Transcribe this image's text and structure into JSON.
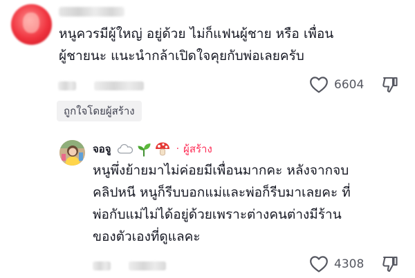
{
  "comments": [
    {
      "body": "หนูควรมีผู้ใหญ่ อยู่ด้วย ไม่ก็แฟนผู้ชาย หรือ เพื่อน\nผู้ชายนะ แนะนำกล้าเปิดใจคุยกับพ่อเลยครับ",
      "like_count": "6604",
      "liked_by_creator_label": "ถูกใจโดยผู้สร้าง"
    },
    {
      "author": "จอจู",
      "creator_label": "ผู้สร้าง",
      "creator_separator": "·",
      "body": "หนูพึ่งย้ายมาไม่ค่อยมีเพื่อนมากคะ หลังจากจบ\nคลิปหนี หนูก็รีบบอกแม่และพ่อก็รีบมาเลยคะ ที่\nพ่อกับแม่ไม่ได้อยู่ด้วยเพราะต่างคนต่างมีร้าน\nของตัวเองที่ดูแลคะ",
      "like_count": "4308"
    }
  ],
  "colors": {
    "accent": "#fe2c55",
    "text": "#161823",
    "secondary": "#555760",
    "badge_bg": "#f1f1f2"
  },
  "icons": {
    "like": "heart-outline-icon",
    "dislike": "thumbs-down-outline-icon",
    "author_emoji": [
      "cloud-emoji-icon",
      "seedling-emoji-icon",
      "mushroom-emoji-icon"
    ]
  }
}
